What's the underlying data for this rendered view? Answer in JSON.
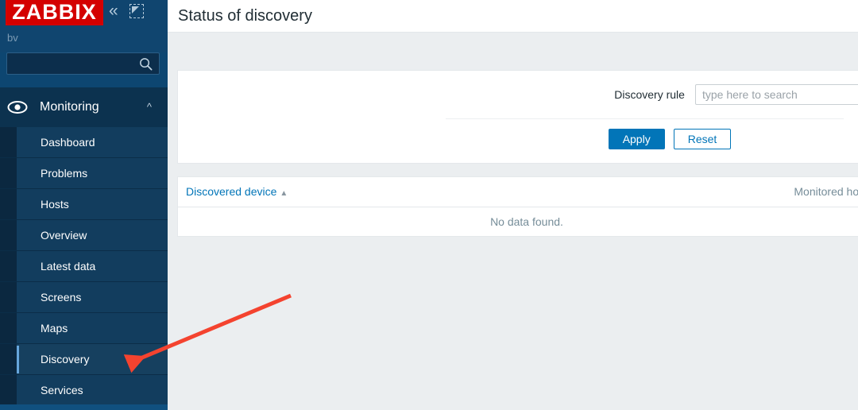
{
  "sidebar": {
    "logo_text": "ZABBIX",
    "server_name": "bv",
    "collapse_icon": "chevron-double-left-icon",
    "kiosk_icon": "kiosk-expand-icon",
    "search": {
      "value": "",
      "placeholder": ""
    },
    "section": {
      "title": "Monitoring",
      "icon": "eye-icon",
      "chevron": "chevron-up-icon",
      "expanded": true
    },
    "items": [
      {
        "label": "Dashboard",
        "selected": false
      },
      {
        "label": "Problems",
        "selected": false
      },
      {
        "label": "Hosts",
        "selected": false
      },
      {
        "label": "Overview",
        "selected": false
      },
      {
        "label": "Latest data",
        "selected": false
      },
      {
        "label": "Screens",
        "selected": false
      },
      {
        "label": "Maps",
        "selected": false
      },
      {
        "label": "Discovery",
        "selected": true
      },
      {
        "label": "Services",
        "selected": false
      }
    ]
  },
  "header": {
    "title": "Status of discovery"
  },
  "filter": {
    "discovery_rule_label": "Discovery rule",
    "discovery_rule_value": "",
    "discovery_rule_placeholder": "type here to search",
    "apply_label": "Apply",
    "reset_label": "Reset"
  },
  "table": {
    "columns": [
      {
        "label": "Discovered device",
        "sortable": true,
        "sort_direction": "▲"
      },
      {
        "label": "Monitored host",
        "sortable": false,
        "sort_direction": ""
      }
    ],
    "rows": [],
    "empty_message": "No data found."
  },
  "annotation": {
    "arrow_color": "#f4432f",
    "points_to": "Discovery"
  },
  "colors": {
    "brand_red": "#d40000",
    "sidebar_bg": "#0d4671",
    "accent_blue": "#0275b8",
    "page_bg": "#ebeef0"
  }
}
